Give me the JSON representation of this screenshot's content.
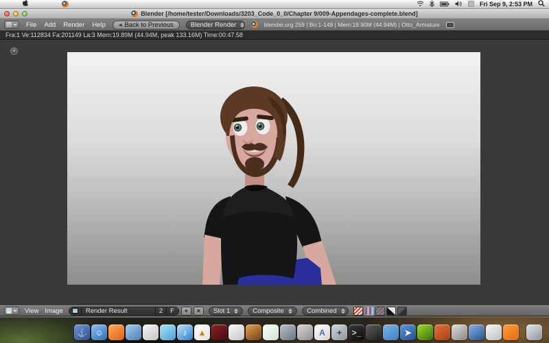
{
  "menubar": {
    "clock": "Fri Sep 9,  2:53 PM"
  },
  "window_title": "Blender [/home/tester/Downloads/3203_Code_0_0/Chapter 9/009-Appendages-complete.blend]",
  "info_header": {
    "menus": [
      "File",
      "Add",
      "Render",
      "Help"
    ],
    "back_button": "Back to Previous",
    "engine": "Blender Render",
    "status": "blender.org 259 | Bo:1-149  | Mem:19.90M (44.94M) | Otto_Armature"
  },
  "render_stats": "Fra:1  Ve:112834 Fa:201149 La:3 Mem:19.89M (44.94M, peak 133.16M) Time:00:47.58",
  "image_header": {
    "menus": [
      "View",
      "Image"
    ],
    "image_name": "Render Result",
    "users": "2",
    "fake_user": "F",
    "slot": "Slot 1",
    "layer": "Composite",
    "pass": "Combined"
  },
  "icons": {
    "back_arrow": "◂",
    "plus": "+",
    "close": "×",
    "region_plus": "+"
  },
  "render_colors": {
    "bg_top": "#f1f1f1",
    "bg_bottom": "#8d8d8d",
    "skin": "#d8a79e",
    "skin_shadow": "#c28d85",
    "hair": "#5b3922",
    "hair_dark": "#452a15",
    "beard": "#4a2f1c",
    "shirt": "#161616",
    "pants": "#2b2f9c",
    "iris": "#5d7d74",
    "mouth": "#8a5550"
  },
  "dock": {
    "items": [
      {
        "name": "anchor-app",
        "glyph": "⚓",
        "c1": "#6f94d6",
        "c2": "#2c4f93",
        "fg": "#ffffff"
      },
      {
        "name": "finder",
        "glyph": "☺",
        "c1": "#8fc1f0",
        "c2": "#2f6fc0",
        "fg": "#ffffff"
      },
      {
        "name": "firefox",
        "glyph": "",
        "c1": "#ffb05c",
        "c2": "#e05e10",
        "fg": "#ffffff"
      },
      {
        "name": "browser-globe",
        "glyph": "",
        "c1": "#a8cdee",
        "c2": "#4a7fb5",
        "fg": "#ffffff"
      },
      {
        "name": "preview",
        "glyph": "",
        "c1": "#f6f6f6",
        "c2": "#c3c3c3",
        "fg": "#555555"
      },
      {
        "name": "chat",
        "glyph": "",
        "c1": "#aee4f8",
        "c2": "#4a9fd8",
        "fg": "#ffffff"
      },
      {
        "name": "itunes",
        "glyph": "♪",
        "c1": "#bfe3f7",
        "c2": "#2f7fd0",
        "fg": "#ffffff"
      },
      {
        "name": "vlc",
        "glyph": "▲",
        "c1": "#ffffff",
        "c2": "#e2e2e2",
        "fg": "#e8740c"
      },
      {
        "name": "dvd-player",
        "glyph": "",
        "c1": "#8c1f24",
        "c2": "#430c10",
        "fg": "#ffffff"
      },
      {
        "name": "photo-booth",
        "glyph": "",
        "c1": "#fafafa",
        "c2": "#c4c4c4",
        "fg": "#333333"
      },
      {
        "name": "quicktime",
        "glyph": "",
        "c1": "#e8a050",
        "c2": "#6e4216",
        "fg": "#ffffff"
      },
      {
        "name": "feather-notes",
        "glyph": "",
        "c1": "#ffffff",
        "c2": "#cfe2cd",
        "fg": "#3a8a3a"
      },
      {
        "name": "image-capture",
        "glyph": "",
        "c1": "#b8c4d0",
        "c2": "#67737f",
        "fg": "#ffffff"
      },
      {
        "name": "scanner",
        "glyph": "",
        "c1": "#d8d8d8",
        "c2": "#8d8d8d",
        "fg": "#444444"
      },
      {
        "name": "textedit",
        "glyph": "A",
        "c1": "#ffffff",
        "c2": "#d4d4d4",
        "fg": "#4a6fa5"
      },
      {
        "name": "calculator",
        "glyph": "+",
        "c1": "#cfd6dc",
        "c2": "#8d979f",
        "fg": "#333333"
      },
      {
        "name": "terminal",
        "glyph": ">_",
        "c1": "#3c3c3c",
        "c2": "#0a0a0a",
        "fg": "#cccccc"
      },
      {
        "name": "system-prefs",
        "glyph": "",
        "c1": "#5e5e5e",
        "c2": "#1e1e1e",
        "fg": "#dddddd"
      },
      {
        "name": "folder",
        "glyph": "",
        "c1": "#7fb4e4",
        "c2": "#3d7fc2",
        "fg": "#ffffff"
      },
      {
        "name": "remote-desktop",
        "glyph": "➤",
        "c1": "#5a9ae0",
        "c2": "#244f93",
        "fg": "#ffffff"
      },
      {
        "name": "nvidia-settings",
        "glyph": "",
        "c1": "#9adb2e",
        "c2": "#3f6e0d",
        "fg": "#0a0a0a"
      },
      {
        "name": "ubuntu-software",
        "glyph": "",
        "c1": "#e8703a",
        "c2": "#a84010",
        "fg": "#ffffff"
      },
      {
        "name": "printer",
        "glyph": "",
        "c1": "#e0e0e0",
        "c2": "#848484",
        "fg": "#444444"
      },
      {
        "name": "software-update",
        "glyph": "",
        "c1": "#8ab4e8",
        "c2": "#24508e",
        "fg": "#ffffff"
      },
      {
        "name": "photos-stack",
        "glyph": "",
        "c1": "#f8f8f8",
        "c2": "#bdbdbd",
        "fg": "#555555"
      },
      {
        "name": "blender-dock",
        "glyph": "",
        "c1": "#ff9d3c",
        "c2": "#e46b12",
        "fg": "#ffffff"
      },
      {
        "name": "trash",
        "glyph": "",
        "c1": "#dfe4e9",
        "c2": "#8f979e",
        "fg": "#555555",
        "gap": true
      }
    ]
  }
}
